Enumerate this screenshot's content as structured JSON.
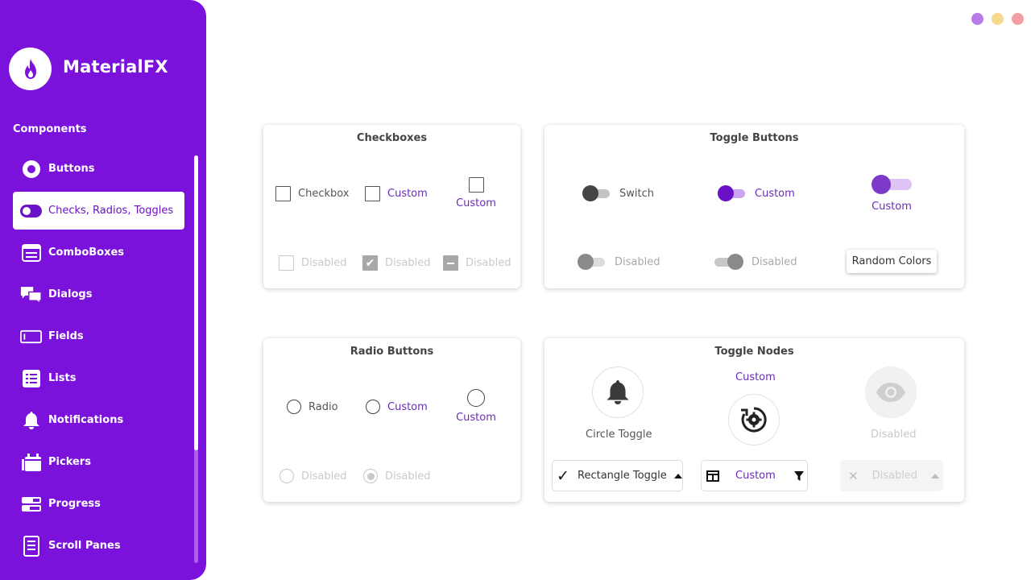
{
  "app": {
    "brand": "MaterialFX"
  },
  "window_dots": [
    {
      "name": "minimize",
      "color": "#b77be7"
    },
    {
      "name": "maximize",
      "color": "#f7d98d"
    },
    {
      "name": "close",
      "color": "#f2a0a6"
    }
  ],
  "sidebar": {
    "section_title": "Components",
    "active_index": 1,
    "items": [
      {
        "label": "Buttons",
        "icon": "radio-circle-icon"
      },
      {
        "label": "Checks, Radios, Toggles",
        "icon": "toggle-icon"
      },
      {
        "label": "ComboBoxes",
        "icon": "combobox-icon"
      },
      {
        "label": "Dialogs",
        "icon": "dialogs-icon"
      },
      {
        "label": "Fields",
        "icon": "field-icon"
      },
      {
        "label": "Lists",
        "icon": "list-icon"
      },
      {
        "label": "Notifications",
        "icon": "bell-icon"
      },
      {
        "label": "Pickers",
        "icon": "calendar-icon"
      },
      {
        "label": "Progress",
        "icon": "progress-icon"
      },
      {
        "label": "Scroll Panes",
        "icon": "document-icon"
      }
    ]
  },
  "checkboxes": {
    "title": "Checkboxes",
    "checkbox": "Checkbox",
    "custom1": "Custom",
    "custom2": "Custom",
    "disabled1": "Disabled",
    "disabled2": "Disabled",
    "disabled3": "Disabled"
  },
  "toggle_buttons": {
    "title": "Toggle Buttons",
    "switch": "Switch",
    "custom1": "Custom",
    "custom2": "Custom",
    "disabled1": "Disabled",
    "disabled2": "Disabled",
    "random_colors": "Random Colors"
  },
  "radio_buttons": {
    "title": "Radio Buttons",
    "radio": "Radio",
    "custom1": "Custom",
    "custom2": "Custom",
    "disabled1": "Disabled",
    "disabled2": "Disabled"
  },
  "toggle_nodes": {
    "title": "Toggle Nodes",
    "circle_toggle": "Circle Toggle",
    "custom_label": "Custom",
    "disabled_label": "Disabled",
    "rectangle_toggle": "Rectangle Toggle",
    "custom_rect": "Custom",
    "disabled_rect": "Disabled"
  },
  "colors": {
    "accent": "#7a12dc",
    "custom_text": "#6a2cb8"
  }
}
